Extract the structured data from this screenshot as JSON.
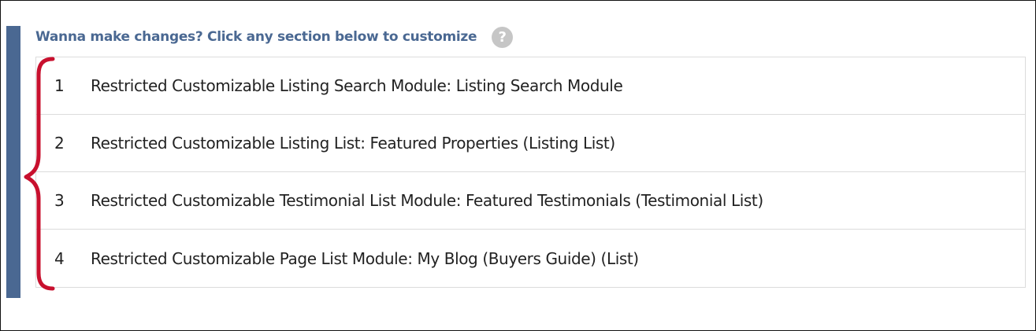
{
  "header": {
    "title": "Wanna make changes? Click any section below to customize",
    "help_icon_glyph": "?"
  },
  "sections": [
    {
      "number": "1",
      "label": "Restricted Customizable Listing Search Module: Listing Search Module"
    },
    {
      "number": "2",
      "label": "Restricted Customizable Listing List: Featured Properties (Listing List)"
    },
    {
      "number": "3",
      "label": "Restricted Customizable Testimonial List Module: Featured Testimonials (Testimonial List)"
    },
    {
      "number": "4",
      "label": "Restricted Customizable Page List Module: My Blog (Buyers Guide) (List)"
    }
  ],
  "colors": {
    "accent": "#4a6892",
    "annotation_brace": "#c8102e",
    "help_icon": "#c6c6c6",
    "row_border": "#dcdcdc"
  },
  "icons": {
    "help": "question-circle-icon",
    "annotation": "curly-brace-annotation"
  }
}
